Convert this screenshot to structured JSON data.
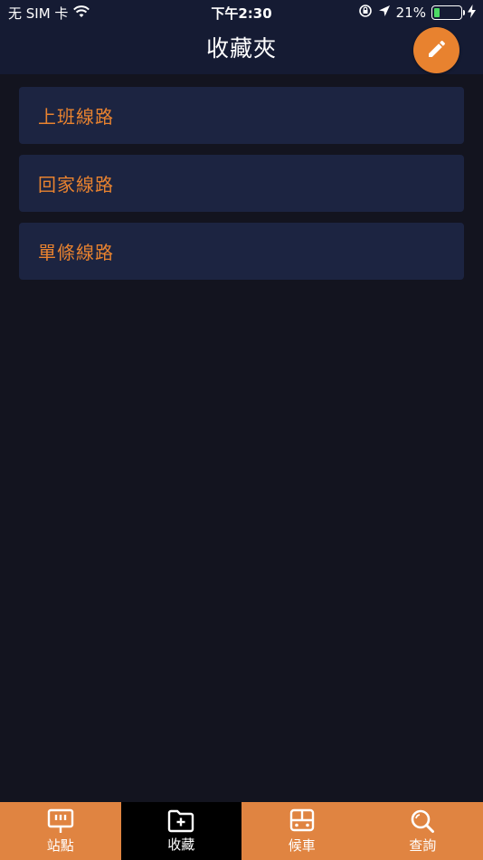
{
  "status": {
    "carrier": "无 SIM 卡",
    "time": "下午2:30",
    "battery": "21%",
    "battery_level": 0.21
  },
  "header": {
    "title": "收藏夾"
  },
  "favorites": [
    {
      "label": "上班線路"
    },
    {
      "label": "回家線路"
    },
    {
      "label": "單條線路"
    }
  ],
  "tabs": [
    {
      "label": "站點",
      "icon": "bus-stop-sign-icon"
    },
    {
      "label": "收藏",
      "icon": "folder-plus-icon",
      "active": true
    },
    {
      "label": "候車",
      "icon": "bus-front-icon"
    },
    {
      "label": "查詢",
      "icon": "search-icon"
    }
  ],
  "colors": {
    "accent": "#e8822f",
    "header_bg": "#151b33",
    "card_bg": "#1c2441",
    "page_bg": "#13141f"
  }
}
